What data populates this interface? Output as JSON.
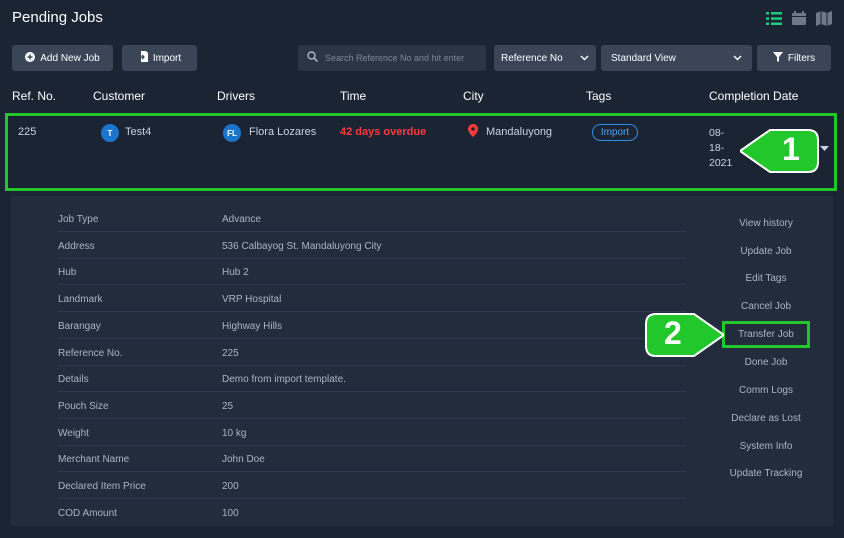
{
  "header": {
    "title": "Pending Jobs"
  },
  "toolbar": {
    "add_label": "Add New Job",
    "import_label": "Import",
    "search_placeholder": "Search Reference No and hit enter",
    "search_by": "Reference No",
    "view": "Standard View",
    "filters_label": "Filters"
  },
  "table": {
    "columns": [
      "Ref. No.",
      "Customer",
      "Drivers",
      "Time",
      "City",
      "Tags",
      "Completion Date"
    ],
    "row": {
      "ref": "225",
      "customer_initial": "T",
      "customer": "Test4",
      "driver_initials": "FL",
      "driver": "Flora Lozares",
      "time": "42 days overdue",
      "city": "Mandaluyong",
      "tag": "Import",
      "date_l1": "08-",
      "date_l2": "18-",
      "date_l3": "2021"
    }
  },
  "details": [
    {
      "label": "Job Type",
      "value": "Advance"
    },
    {
      "label": "Address",
      "value": "536 Calbayog St. Mandaluyong City"
    },
    {
      "label": "Hub",
      "value": "Hub 2"
    },
    {
      "label": "Landmark",
      "value": "VRP Hospital"
    },
    {
      "label": "Barangay",
      "value": "Highway Hills"
    },
    {
      "label": "Reference No.",
      "value": "225"
    },
    {
      "label": "Details",
      "value": "Demo from import template."
    },
    {
      "label": "Pouch Size",
      "value": "25"
    },
    {
      "label": "Weight",
      "value": "10 kg"
    },
    {
      "label": "Merchant Name",
      "value": "John Doe"
    },
    {
      "label": "Declared Item Price",
      "value": "200"
    },
    {
      "label": "COD Amount",
      "value": "100"
    }
  ],
  "actions": [
    "View history",
    "Update Job",
    "Edit Tags",
    "Cancel Job",
    "Transfer Job",
    "Done Job",
    "Comm Logs",
    "Declare as Lost",
    "System Info",
    "Update Tracking"
  ],
  "callouts": {
    "one": "1",
    "two": "2"
  },
  "colors": {
    "highlight": "#22c72c",
    "overdue": "#ff3b3b",
    "accent": "#1a76cc",
    "active_view": "#1fc87a"
  }
}
